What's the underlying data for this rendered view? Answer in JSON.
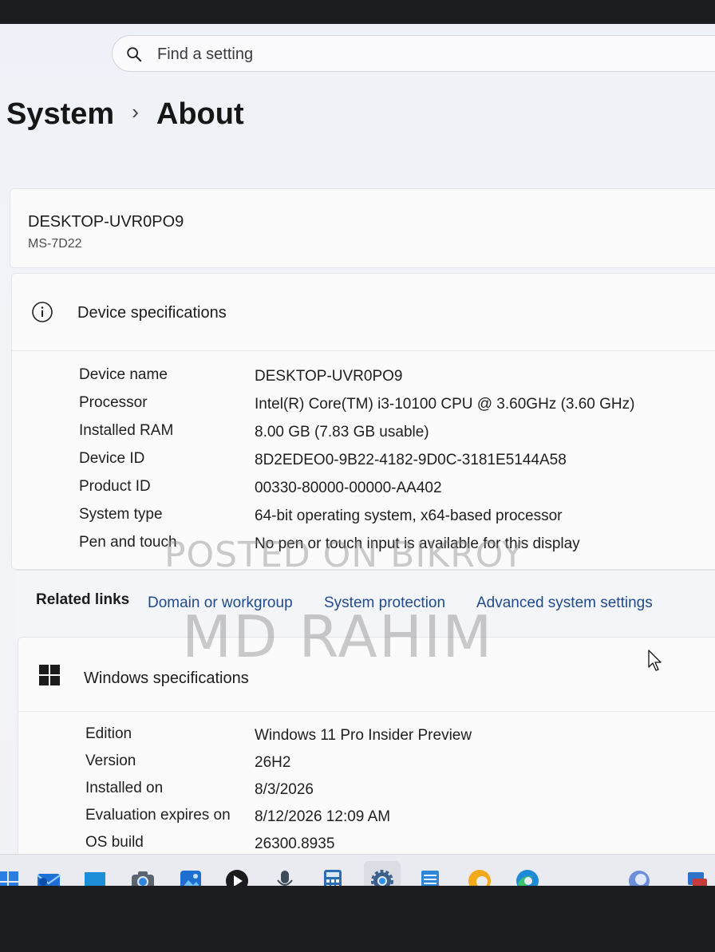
{
  "search": {
    "placeholder": "Find a setting"
  },
  "breadcrumb": {
    "parent": "System",
    "separator": "›",
    "current": "About"
  },
  "device": {
    "name": "DESKTOP-UVR0PO9",
    "model": "MS-7D22"
  },
  "device_specs": {
    "title": "Device specifications",
    "rows": [
      {
        "label": "Device name",
        "value": "DESKTOP-UVR0PO9"
      },
      {
        "label": "Processor",
        "value": "Intel(R) Core(TM) i3-10100 CPU @ 3.60GHz (3.60 GHz)"
      },
      {
        "label": "Installed RAM",
        "value": "8.00 GB (7.83 GB usable)"
      },
      {
        "label": "Device ID",
        "value": "8D2EDEO0-9B22-4182-9D0C-3181E5144A58"
      },
      {
        "label": "Product ID",
        "value": "00330-80000-00000-AA402"
      },
      {
        "label": "System type",
        "value": "64-bit operating system, x64-based processor"
      },
      {
        "label": "Pen and touch",
        "value": "No pen or touch input is available for this display"
      }
    ]
  },
  "related_links": {
    "label": "Related links",
    "links": [
      "Domain or workgroup",
      "System protection",
      "Advanced system settings"
    ]
  },
  "windows_specs": {
    "title": "Windows specifications",
    "rows": [
      {
        "label": "Edition",
        "value": "Windows 11 Pro Insider Preview"
      },
      {
        "label": "Version",
        "value": "26H2"
      },
      {
        "label": "Installed on",
        "value": "8/3/2026"
      },
      {
        "label": "Evaluation expires on",
        "value": "8/12/2026 12:09 AM"
      },
      {
        "label": "OS build",
        "value": "26300.8935"
      }
    ]
  },
  "watermark": {
    "line1": "POSTED ON BIKROY",
    "line2": "MD RAHIM"
  },
  "taskbar": {
    "icons": [
      "start-icon",
      "outlook-icon",
      "store-icon",
      "camera-icon",
      "photos-icon",
      "media-player-icon",
      "voice-recorder-icon",
      "calculator-icon",
      "settings-icon",
      "notepad-icon",
      "edge-canary-icon",
      "edge-icon",
      "copilot-icon",
      "tray-icon"
    ],
    "active": "settings-icon"
  },
  "colors": {
    "accent": "#1f5fbf",
    "link": "#1f4a8c",
    "background": "#eef1f7"
  }
}
